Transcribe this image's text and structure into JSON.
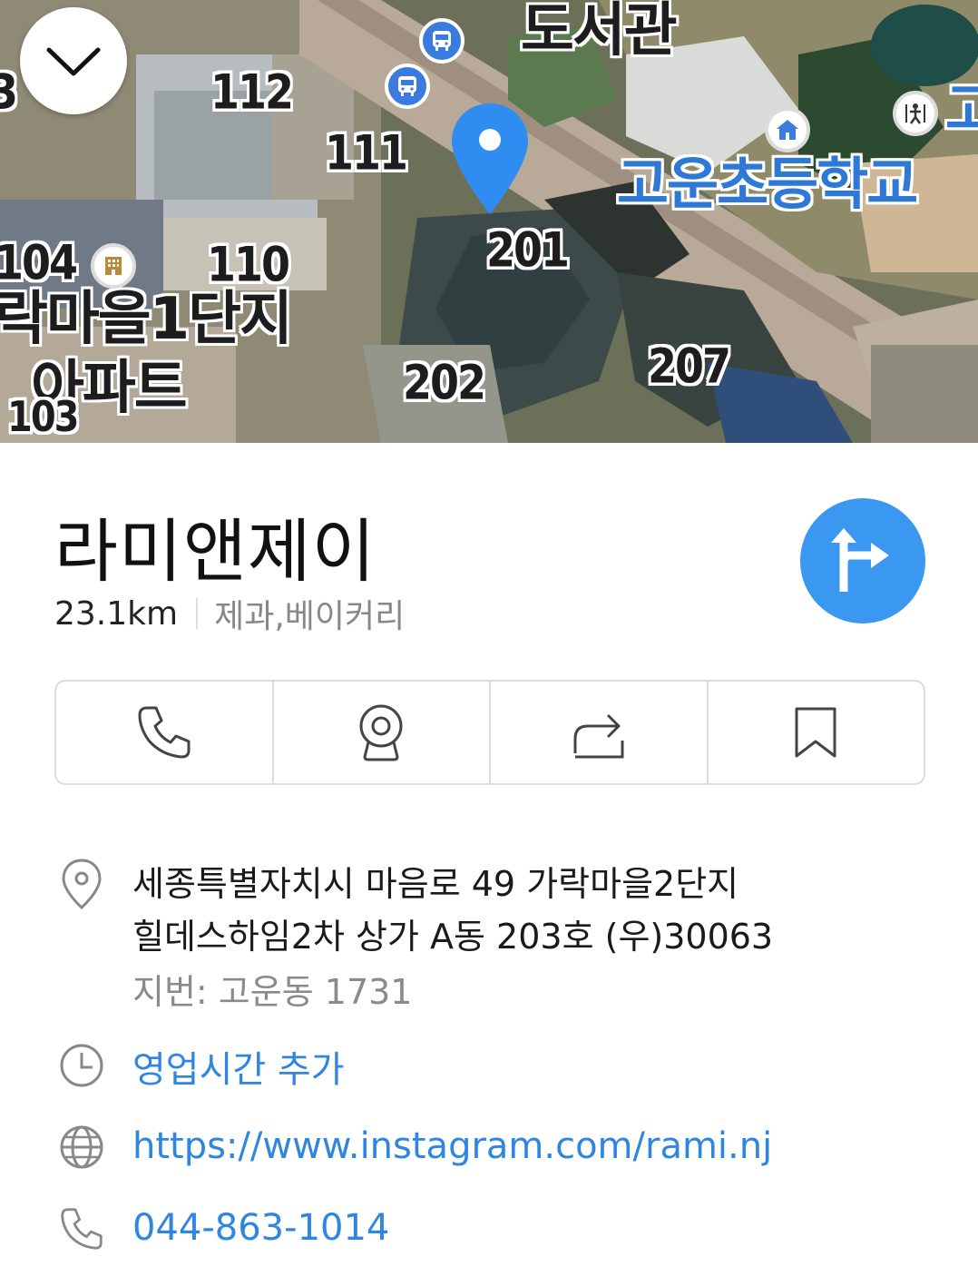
{
  "map": {
    "labels": {
      "library": "도서관",
      "school": "고운초등학교",
      "school_edge": "고",
      "apt_complex_line1": "락마을1단지",
      "apt_complex_line2": "아파트",
      "b112": "112",
      "b111": "111",
      "b110": "110",
      "b104": "104",
      "b103": "103",
      "b201": "201",
      "b202": "202",
      "b207": "207",
      "edge3": "3"
    },
    "pois": [
      "bus-stop-icon",
      "bus-stop-icon",
      "building-icon",
      "school-icon",
      "playground-icon"
    ],
    "pin_color": "#2f8cf0"
  },
  "place": {
    "name": "라미앤제이",
    "distance": "23.1km",
    "category": "제과,베이커리"
  },
  "actions": [
    {
      "name": "call",
      "icon": "phone-icon"
    },
    {
      "name": "roadview",
      "icon": "camera-icon"
    },
    {
      "name": "share",
      "icon": "share-icon"
    },
    {
      "name": "save",
      "icon": "bookmark-icon"
    }
  ],
  "info": {
    "address_line1": "세종특별자치시 마음로 49 가락마을2단지",
    "address_line2": "힐데스하임2차 상가 A동 203호 (우)30063",
    "jibun": "지번: 고운동 1731",
    "hours_link": "영업시간 추가",
    "website": "https://www.instagram.com/rami.nj",
    "phone": "044-863-1014"
  },
  "colors": {
    "accent": "#3a98f0",
    "link": "#2f86e0",
    "muted": "#888888"
  }
}
